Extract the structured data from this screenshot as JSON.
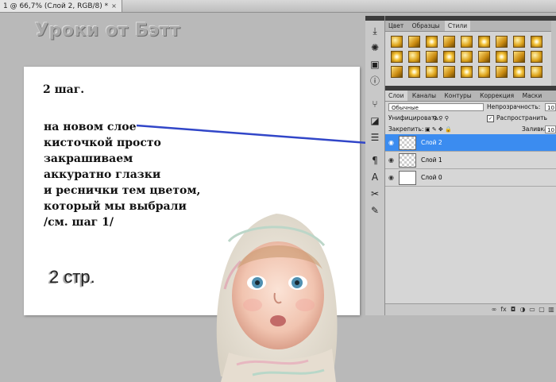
{
  "document_tab": {
    "title": "1 @ 66,7% (Слой 2, RGB/8) *",
    "close": "×"
  },
  "watermark": "Уроки от Бэтт",
  "canvas": {
    "step_title": "2 шаг.",
    "instructions": [
      "на новом слое",
      "кисточкой просто",
      "закрашиваем",
      "аккуратно глазки",
      "и реснички тем цветом,",
      "который мы выбрали",
      "/см. шаг 1/"
    ],
    "page_label": "2 стр."
  },
  "colors": {
    "selected_layer": "#3b8cf0",
    "arrow": "#3146c8",
    "panel_bg": "#d6d6d6"
  },
  "toolstrip": [
    "history-icon",
    "image-icon",
    "info-icon",
    "tools-icon",
    "layers-icon",
    "paragraph-icon",
    "character-icon",
    "transform-icon",
    "brush-icon"
  ],
  "styles_panel": {
    "tabs": [
      "Цвет",
      "Образцы",
      "Стили"
    ],
    "active_tab": "Стили"
  },
  "layers_panel": {
    "tabs": [
      "Слои",
      "Каналы",
      "Контуры",
      "Коррекция",
      "Маски"
    ],
    "active_tab": "Слои",
    "blend_mode": "Обычные",
    "opacity_label": "Непрозрачность:",
    "opacity_value": "10",
    "unify_label": "Унифицировать:",
    "propagate_label": "Распространить",
    "lock_label": "Закрепить:",
    "fill_label": "Заливка:",
    "fill_value": "10",
    "layers": [
      {
        "name": "Слой 2",
        "selected": true
      },
      {
        "name": "Слой 1",
        "selected": false
      },
      {
        "name": "Слой 0",
        "selected": false
      }
    ]
  }
}
